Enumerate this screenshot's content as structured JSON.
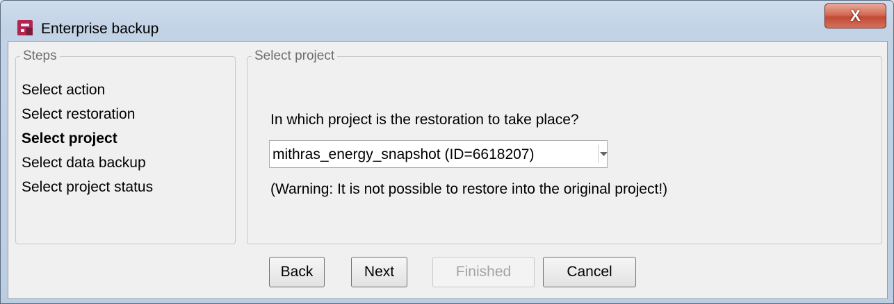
{
  "window": {
    "title": "Enterprise backup",
    "close_label": "X"
  },
  "steps": {
    "legend": "Steps",
    "items": [
      {
        "label": "Select action"
      },
      {
        "label": "Select restoration"
      },
      {
        "label": "Select project"
      },
      {
        "label": "Select data backup"
      },
      {
        "label": "Select project status"
      }
    ],
    "current_index": 2
  },
  "main": {
    "legend": "Select project",
    "question": "In which project is the restoration to take place?",
    "project_select": {
      "value": "mithras_energy_snapshot (ID=6618207)"
    },
    "warning": "(Warning: It is not possible to restore into the original project!)"
  },
  "buttons": {
    "back": "Back",
    "next": "Next",
    "finished": "Finished",
    "cancel": "Cancel"
  },
  "colors": {
    "close_button": "#c24a35",
    "app_icon": "#b3244f"
  }
}
